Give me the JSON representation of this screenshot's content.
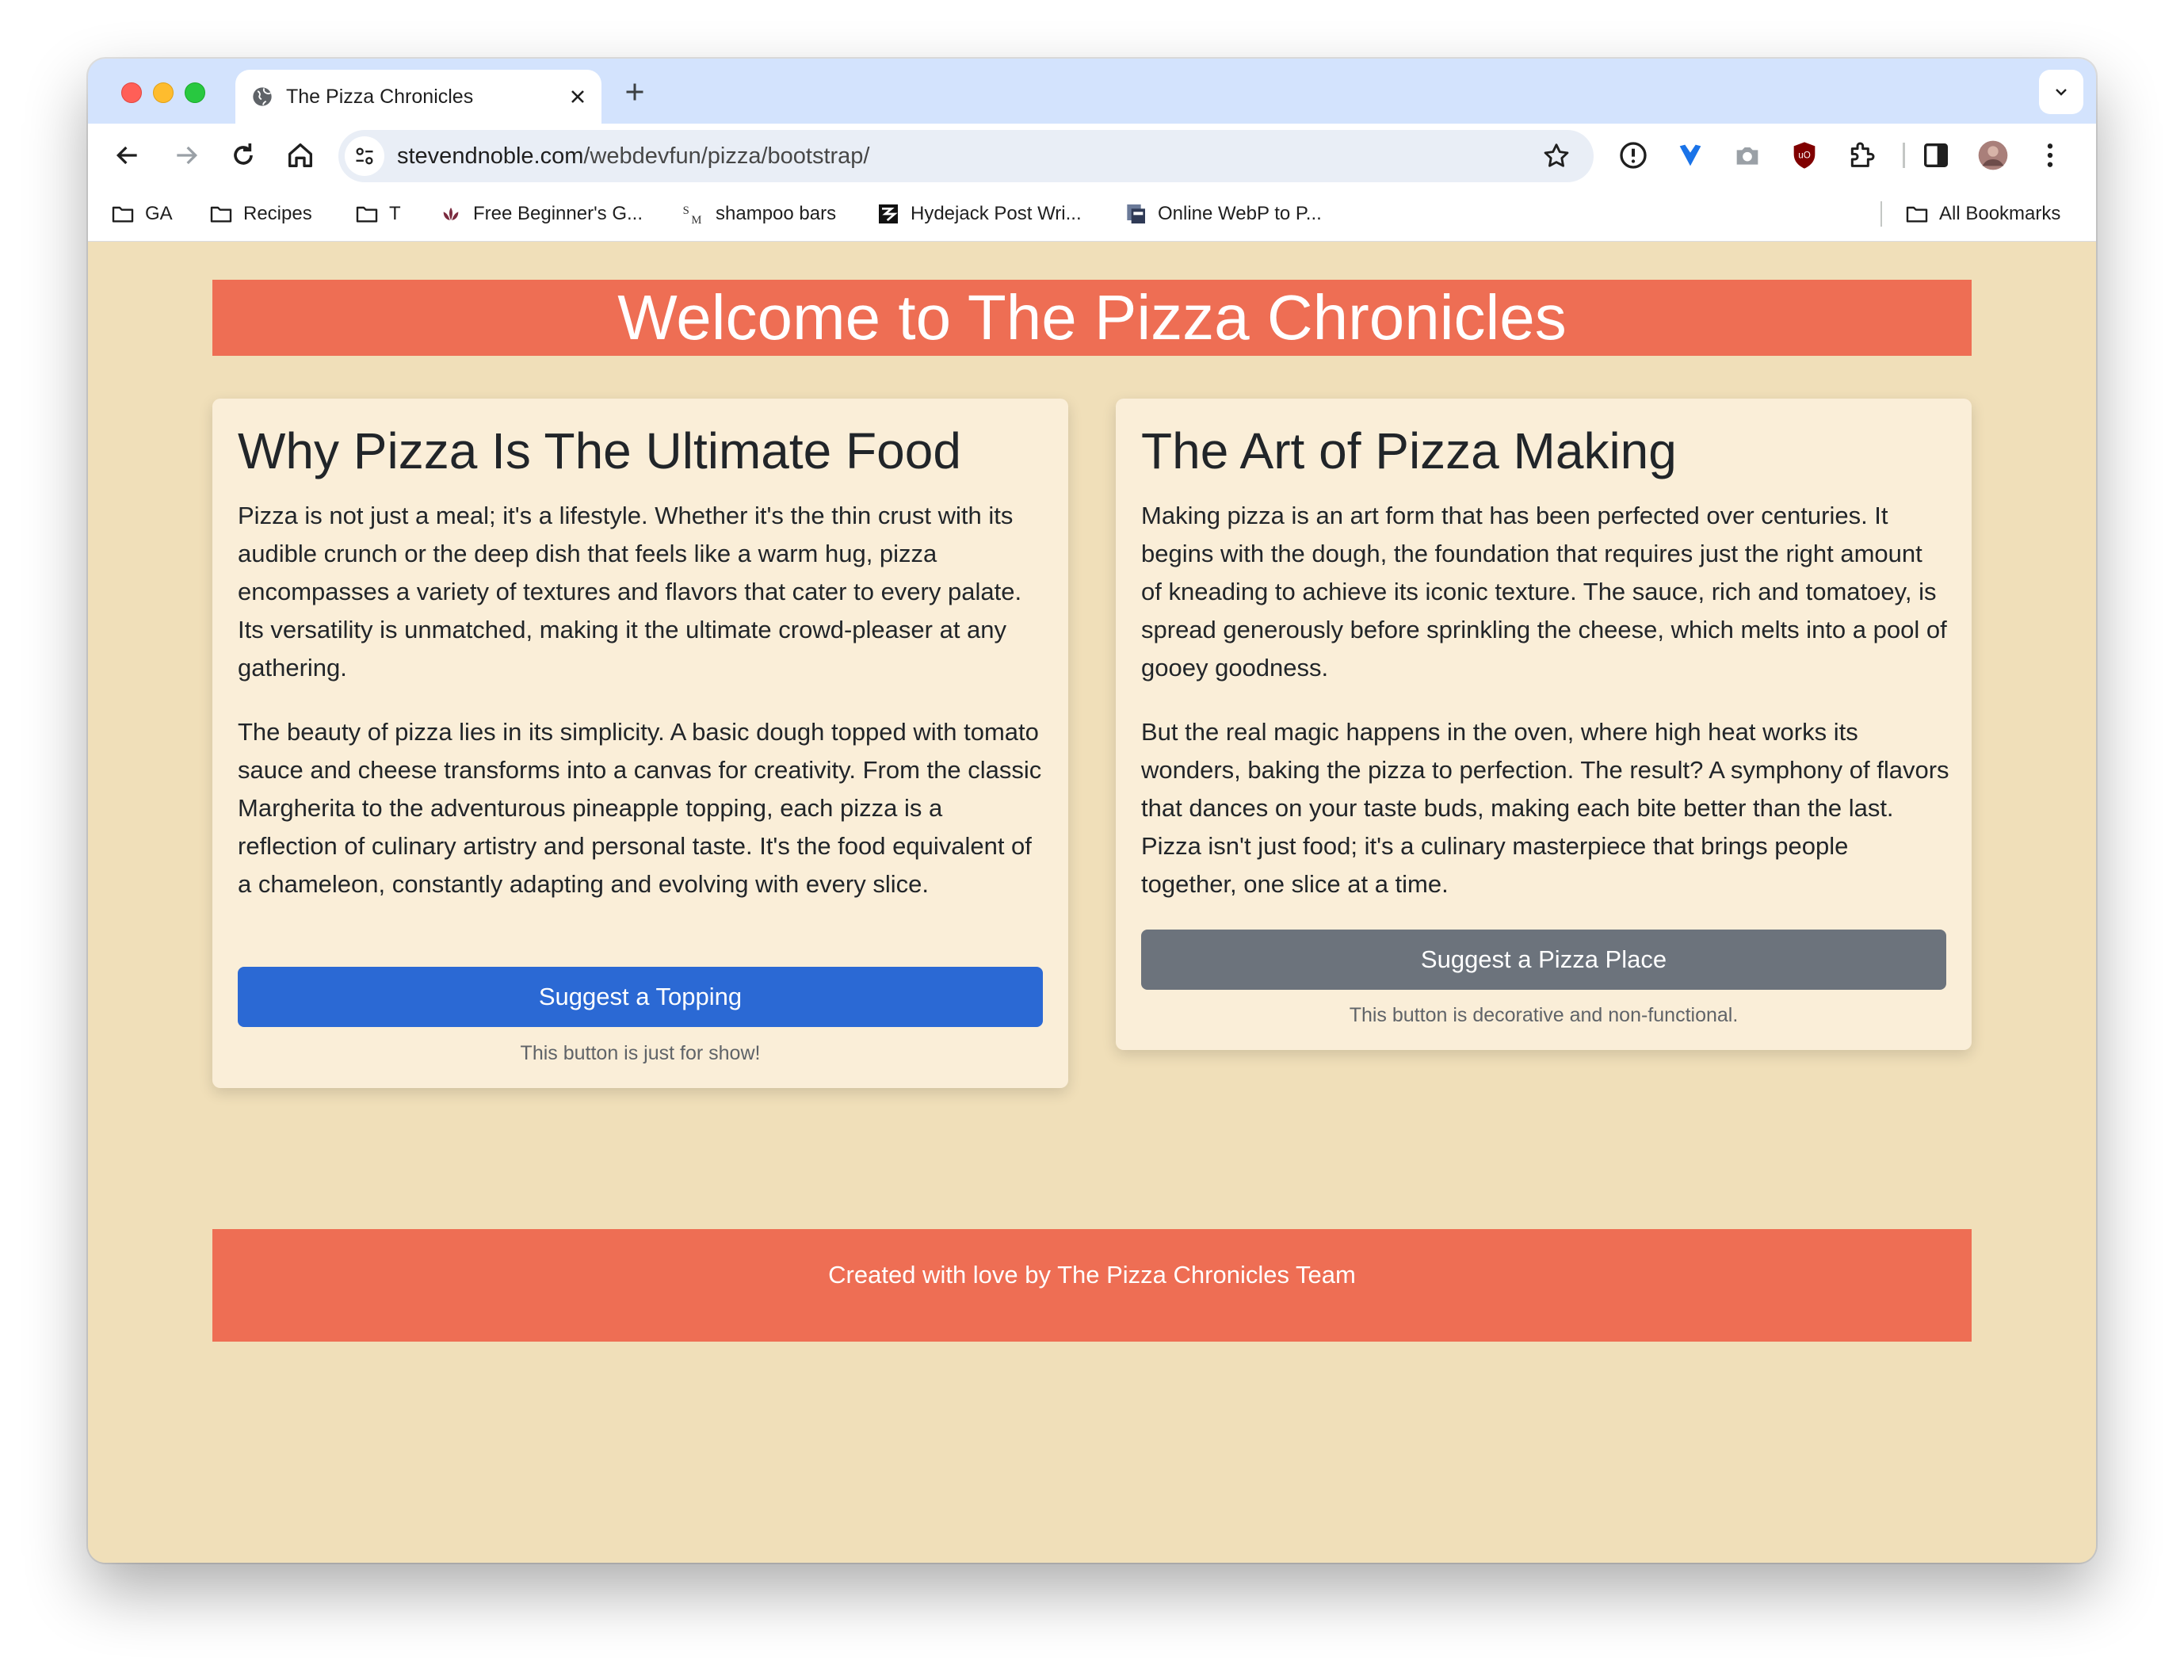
{
  "browser": {
    "tab_title": "The Pizza Chronicles",
    "url_host": "stevendnoble.com",
    "url_path": "/webdevfun/pizza/bootstrap/",
    "bookmarks": [
      {
        "label": "GA",
        "icon": "folder-icon"
      },
      {
        "label": "Recipes",
        "icon": "folder-icon"
      },
      {
        "label": "T",
        "icon": "folder-icon"
      },
      {
        "label": "Free Beginner's G...",
        "icon": "lotus-icon"
      },
      {
        "label": "shampoo bars",
        "icon": "sm-logo-icon"
      },
      {
        "label": "Hydejack Post Wri...",
        "icon": "hydejack-icon"
      },
      {
        "label": "Online WebP to P...",
        "icon": "converter-icon"
      }
    ],
    "all_bookmarks": "All Bookmarks"
  },
  "page": {
    "title": "Welcome to The Pizza Chronicles",
    "cards": [
      {
        "heading": "Why Pizza Is The Ultimate Food",
        "paragraphs": [
          "Pizza is not just a meal; it's a lifestyle. Whether it's the thin crust with its audible crunch or the deep dish that feels like a warm hug, pizza encompasses a variety of textures and flavors that cater to every palate. Its versatility is unmatched, making it the ultimate crowd-pleaser at any gathering.",
          "The beauty of pizza lies in its simplicity. A basic dough topped with tomato sauce and cheese transforms into a canvas for creativity. From the classic Margherita to the adventurous pineapple topping, each pizza is a reflection of culinary artistry and personal taste. It's the food equivalent of a chameleon, constantly adapting and evolving with every slice."
        ],
        "button": "Suggest a Topping",
        "note": "This button is just for show!"
      },
      {
        "heading": "The Art of Pizza Making",
        "paragraphs": [
          "Making pizza is an art form that has been perfected over centuries. It begins with the dough, the foundation that requires just the right amount of kneading to achieve its iconic texture. The sauce, rich and tomatoey, is spread generously before sprinkling the cheese, which melts into a pool of gooey goodness.",
          "But the real magic happens in the oven, where high heat works its wonders, baking the pizza to perfection. The result? A symphony of flavors that dances on your taste buds, making each bite better than the last. Pizza isn't just food; it's a culinary masterpiece that brings people together, one slice at a time."
        ],
        "button": "Suggest a Pizza Place",
        "note": "This button is decorative and non-functional."
      }
    ],
    "footer": "Created with love by The Pizza Chronicles Team"
  },
  "colors": {
    "page_background": "#f0dfb9",
    "banner": "#ee6e54",
    "card_background": "#faeed8",
    "primary_button": "#2b69d4",
    "secondary_button": "#6c737c"
  }
}
